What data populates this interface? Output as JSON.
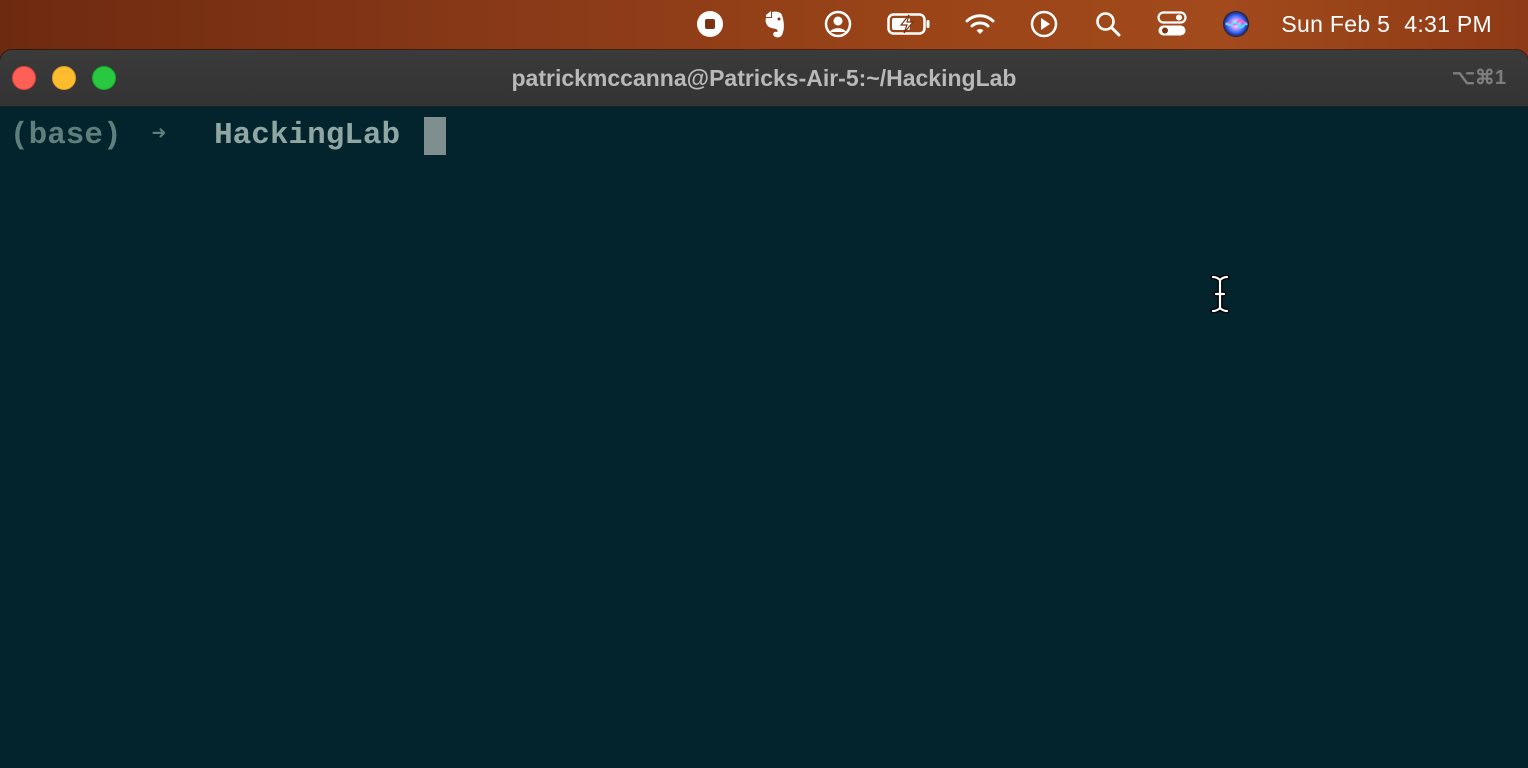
{
  "menubar": {
    "icons": [
      "stop-recording-icon",
      "evernote-icon",
      "user-account-icon",
      "battery-charging-icon",
      "wifi-icon",
      "play-icon",
      "search-icon",
      "control-center-icon",
      "siri-icon"
    ],
    "date": "Sun Feb 5",
    "time": "4:31 PM"
  },
  "window": {
    "title": "patrickmccanna@Patricks-Air-5:~/HackingLab",
    "shortcut": "⌥⌘1"
  },
  "terminal": {
    "env": "(base)",
    "arrow": "➜",
    "directory": "HackingLab"
  },
  "colors": {
    "terminal_bg": "#03242c",
    "prompt_dim": "#5f7f7d",
    "prompt_dir": "#8fa6a3",
    "cursor": "#7f8f8f"
  }
}
